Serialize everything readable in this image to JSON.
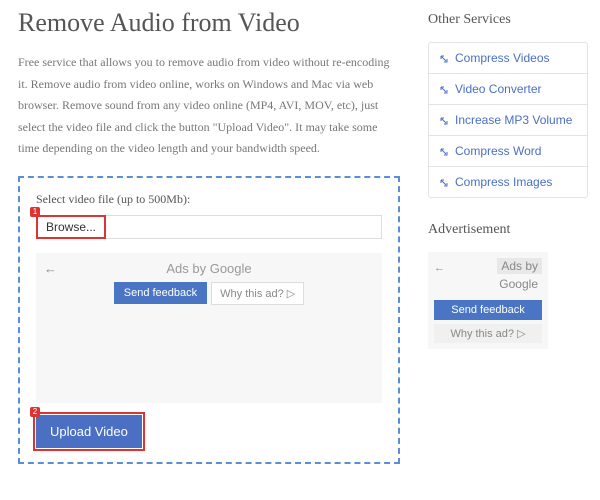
{
  "page": {
    "title": "Remove Audio from Video",
    "intro": "Free service that allows you to remove audio from video without re-encoding it. Remove audio from video online, works on Windows and Mac via web browser. Remove sound from any video online (MP4, AVI, MOV, etc), just select the video file and click the button \"Upload Video\". It may take some time depending on the video length and your bandwidth speed."
  },
  "upload": {
    "label": "Select video file (up to 500Mb):",
    "browse": "Browse...",
    "button": "Upload Video",
    "marker1": "1",
    "marker2": "2"
  },
  "ads": {
    "title": "Ads by Google",
    "back": "←",
    "feedback": "Send feedback",
    "why": "Why this ad? ▷",
    "sb_title1": "Ads by",
    "sb_title2": "Google",
    "sb_feedback": "Send feedback",
    "sb_why": "Why this ad? ▷"
  },
  "sidebar": {
    "services_heading": "Other Services",
    "ad_heading": "Advertisement",
    "items": [
      {
        "label": "Compress Videos"
      },
      {
        "label": "Video Converter"
      },
      {
        "label": "Increase MP3 Volume"
      },
      {
        "label": "Compress Word"
      },
      {
        "label": "Compress Images"
      }
    ]
  }
}
